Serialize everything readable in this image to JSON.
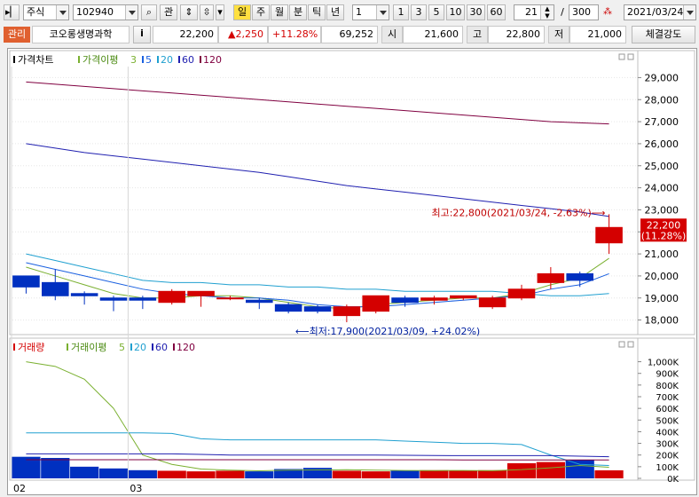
{
  "toolbar": {
    "market_select": "주식",
    "code_input": "102940",
    "search_icon": "magnifier-icon",
    "interest_label": "관",
    "period_buttons": [
      "일",
      "주",
      "월",
      "분",
      "틱",
      "년"
    ],
    "active_period": "일",
    "interval_value": "1",
    "quick_intervals": [
      "1",
      "3",
      "5",
      "10",
      "30",
      "60"
    ],
    "count_value": "21",
    "count_separator": "/",
    "count_total": "300",
    "date_value": "2021/03/24"
  },
  "info": {
    "badge": "관리",
    "name": "코오롱생명과학",
    "info_button": "i",
    "price": "22,200",
    "change": "▲2,250",
    "change_pct": "+11.28%",
    "volume": "69,252",
    "open_label": "시",
    "open": "21,600",
    "high_label": "고",
    "high": "22,800",
    "low_label": "저",
    "low": "21,000",
    "strength_button": "체결강도"
  },
  "price_panel": {
    "title": "가격차트",
    "ma_title": "가격이평",
    "ma_periods": [
      "3",
      "5",
      "20",
      "60",
      "120"
    ],
    "yticks": [
      "29,000",
      "28,000",
      "27,000",
      "26,000",
      "25,000",
      "24,000",
      "23,000",
      "22,000",
      "21,000",
      "20,000",
      "19,000",
      "18,000"
    ],
    "current_price": "22,200",
    "current_pct": "(11.28%)",
    "high_annotation": "최고:22,800(2021/03/24, -2.63%)⟶",
    "low_annotation": "⟵최저:17,900(2021/03/09, +24.02%)"
  },
  "volume_panel": {
    "title": "거래량",
    "ma_title": "거래이평",
    "ma_periods": [
      "5",
      "20",
      "60",
      "120"
    ],
    "yticks": [
      "1,000K",
      "900K",
      "800K",
      "700K",
      "600K",
      "500K",
      "400K",
      "300K",
      "200K",
      "100K",
      "0K"
    ]
  },
  "xaxis": {
    "labels": [
      "02",
      "03"
    ]
  },
  "colors": {
    "up": "#d40000",
    "down": "#0030c0",
    "ma3": "#7ab030",
    "ma5": "#1a60e0",
    "ma20": "#20a0d0",
    "ma60": "#2020b0",
    "ma120": "#800040"
  },
  "chart_data": {
    "type": "candlestick",
    "price_range": [
      17500,
      29500
    ],
    "ohlc": [
      {
        "o": 20000,
        "h": 20000,
        "l": 19200,
        "c": 19500
      },
      {
        "o": 19700,
        "h": 20300,
        "l": 18900,
        "c": 19100
      },
      {
        "o": 19200,
        "h": 19300,
        "l": 18700,
        "c": 19100
      },
      {
        "o": 19000,
        "h": 19100,
        "l": 18400,
        "c": 18900
      },
      {
        "o": 19000,
        "h": 19100,
        "l": 18500,
        "c": 18900
      },
      {
        "o": 18800,
        "h": 19400,
        "l": 18700,
        "c": 19300
      },
      {
        "o": 19100,
        "h": 19300,
        "l": 18600,
        "c": 19300
      },
      {
        "o": 19000,
        "h": 19100,
        "l": 18900,
        "c": 19000
      },
      {
        "o": 18900,
        "h": 19000,
        "l": 18500,
        "c": 18800
      },
      {
        "o": 18700,
        "h": 18800,
        "l": 18300,
        "c": 18400
      },
      {
        "o": 18600,
        "h": 18700,
        "l": 18300,
        "c": 18400
      },
      {
        "o": 18200,
        "h": 18700,
        "l": 17900,
        "c": 18600
      },
      {
        "o": 18400,
        "h": 19100,
        "l": 18300,
        "c": 19100
      },
      {
        "o": 19000,
        "h": 19100,
        "l": 18600,
        "c": 18800
      },
      {
        "o": 18900,
        "h": 19100,
        "l": 18700,
        "c": 19000
      },
      {
        "o": 19000,
        "h": 19100,
        "l": 18900,
        "c": 19100
      },
      {
        "o": 18600,
        "h": 19100,
        "l": 18500,
        "c": 19000
      },
      {
        "o": 19000,
        "h": 19600,
        "l": 18900,
        "c": 19400
      },
      {
        "o": 19700,
        "h": 20400,
        "l": 19400,
        "c": 20100
      },
      {
        "o": 20100,
        "h": 20200,
        "l": 19500,
        "c": 19800
      },
      {
        "o": 21500,
        "h": 22800,
        "l": 21000,
        "c": 22200
      }
    ],
    "ma": {
      "3": [
        20400,
        20000,
        19600,
        19200,
        19000,
        19000,
        19100,
        19100,
        19000,
        18800,
        18600,
        18500,
        18700,
        18800,
        18900,
        19000,
        19000,
        19200,
        19600,
        19900,
        20800
      ],
      "5": [
        20600,
        20300,
        20000,
        19700,
        19400,
        19200,
        19100,
        19000,
        19000,
        18900,
        18700,
        18600,
        18600,
        18700,
        18800,
        18900,
        19000,
        19100,
        19400,
        19600,
        20100
      ],
      "20": [
        21000,
        20700,
        20400,
        20100,
        19800,
        19700,
        19700,
        19600,
        19600,
        19500,
        19500,
        19400,
        19400,
        19300,
        19300,
        19300,
        19300,
        19200,
        19100,
        19100,
        19200
      ],
      "60": [
        26000,
        25800,
        25600,
        25450,
        25300,
        25150,
        25000,
        24850,
        24700,
        24500,
        24300,
        24100,
        23950,
        23800,
        23650,
        23500,
        23350,
        23200,
        23050,
        22900,
        22700
      ],
      "120": [
        28800,
        28700,
        28600,
        28500,
        28400,
        28300,
        28200,
        28100,
        28000,
        27900,
        27800,
        27700,
        27600,
        27500,
        27400,
        27300,
        27200,
        27100,
        27000,
        26950,
        26900
      ]
    },
    "volume_range": [
      0,
      1050
    ],
    "volume": [
      185,
      175,
      100,
      85,
      70,
      65,
      60,
      65,
      60,
      80,
      90,
      65,
      60,
      65,
      70,
      65,
      70,
      130,
      140,
      160,
      69
    ],
    "vol_ma": {
      "5": [
        1000,
        960,
        850,
        600,
        200,
        120,
        80,
        70,
        65,
        70,
        72,
        74,
        70,
        68,
        67,
        68,
        66,
        75,
        90,
        110,
        95
      ],
      "20": [
        390,
        390,
        390,
        390,
        390,
        385,
        340,
        330,
        330,
        330,
        330,
        330,
        330,
        320,
        310,
        300,
        300,
        290,
        200,
        120,
        110
      ],
      "60": [
        210,
        210,
        210,
        210,
        210,
        210,
        205,
        200,
        200,
        200,
        200,
        200,
        200,
        198,
        196,
        195,
        195,
        195,
        195,
        190,
        185
      ],
      "120": [
        160,
        160,
        160,
        160,
        160,
        160,
        160,
        160,
        160,
        160,
        160,
        160,
        160,
        160,
        160,
        158,
        158,
        158,
        158,
        158,
        158
      ]
    },
    "x_labels": [
      "02",
      "03"
    ]
  }
}
